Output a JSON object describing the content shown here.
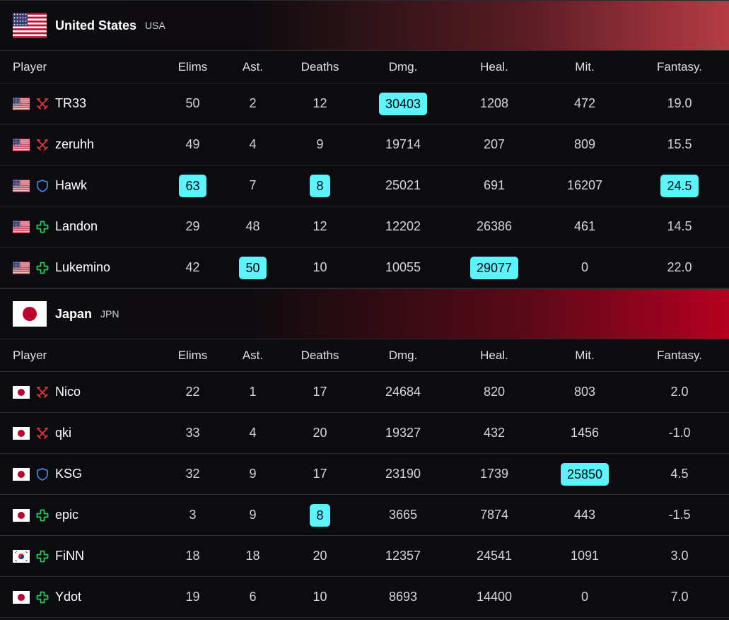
{
  "columns": [
    "Player",
    "Elims",
    "Ast.",
    "Deaths",
    "Dmg.",
    "Heal.",
    "Mit.",
    "Fantasy."
  ],
  "colors": {
    "highlight": "#5ef2fb",
    "dps_icon": "#e0393e",
    "tank_icon": "#3f7fe8",
    "support_icon": "#2ec55a"
  },
  "teams": [
    {
      "name": "United States",
      "code": "USA",
      "flag": "us-flag",
      "players": [
        {
          "flag": "us",
          "role": "dps",
          "name": "TR33",
          "elims": "50",
          "ast": "2",
          "deaths": "12",
          "dmg": "30403",
          "heal": "1208",
          "mit": "472",
          "fantasy": "19.0",
          "hl": [
            "dmg"
          ]
        },
        {
          "flag": "us",
          "role": "dps",
          "name": "zeruhh",
          "elims": "49",
          "ast": "4",
          "deaths": "9",
          "dmg": "19714",
          "heal": "207",
          "mit": "809",
          "fantasy": "15.5",
          "hl": []
        },
        {
          "flag": "us",
          "role": "tank",
          "name": "Hawk",
          "elims": "63",
          "ast": "7",
          "deaths": "8",
          "dmg": "25021",
          "heal": "691",
          "mit": "16207",
          "fantasy": "24.5",
          "hl": [
            "elims",
            "deaths",
            "fantasy"
          ]
        },
        {
          "flag": "us",
          "role": "support",
          "name": "Landon",
          "elims": "29",
          "ast": "48",
          "deaths": "12",
          "dmg": "12202",
          "heal": "26386",
          "mit": "461",
          "fantasy": "14.5",
          "hl": []
        },
        {
          "flag": "us",
          "role": "support",
          "name": "Lukemino",
          "elims": "42",
          "ast": "50",
          "deaths": "10",
          "dmg": "10055",
          "heal": "29077",
          "mit": "0",
          "fantasy": "22.0",
          "hl": [
            "ast",
            "heal"
          ]
        }
      ]
    },
    {
      "name": "Japan",
      "code": "JPN",
      "flag": "jp-flag",
      "players": [
        {
          "flag": "jp",
          "role": "dps",
          "name": "Nico",
          "elims": "22",
          "ast": "1",
          "deaths": "17",
          "dmg": "24684",
          "heal": "820",
          "mit": "803",
          "fantasy": "2.0",
          "hl": []
        },
        {
          "flag": "jp",
          "role": "dps",
          "name": "qki",
          "elims": "33",
          "ast": "4",
          "deaths": "20",
          "dmg": "19327",
          "heal": "432",
          "mit": "1456",
          "fantasy": "-1.0",
          "hl": []
        },
        {
          "flag": "jp",
          "role": "tank",
          "name": "KSG",
          "elims": "32",
          "ast": "9",
          "deaths": "17",
          "dmg": "23190",
          "heal": "1739",
          "mit": "25850",
          "fantasy": "4.5",
          "hl": [
            "mit"
          ]
        },
        {
          "flag": "jp",
          "role": "support",
          "name": "epic",
          "elims": "3",
          "ast": "9",
          "deaths": "8",
          "dmg": "3665",
          "heal": "7874",
          "mit": "443",
          "fantasy": "-1.5",
          "hl": [
            "deaths"
          ]
        },
        {
          "flag": "kr",
          "role": "support",
          "name": "FiNN",
          "elims": "18",
          "ast": "18",
          "deaths": "20",
          "dmg": "12357",
          "heal": "24541",
          "mit": "1091",
          "fantasy": "3.0",
          "hl": []
        },
        {
          "flag": "jp",
          "role": "support",
          "name": "Ydot",
          "elims": "19",
          "ast": "6",
          "deaths": "10",
          "dmg": "8693",
          "heal": "14400",
          "mit": "0",
          "fantasy": "7.0",
          "hl": []
        }
      ]
    }
  ]
}
